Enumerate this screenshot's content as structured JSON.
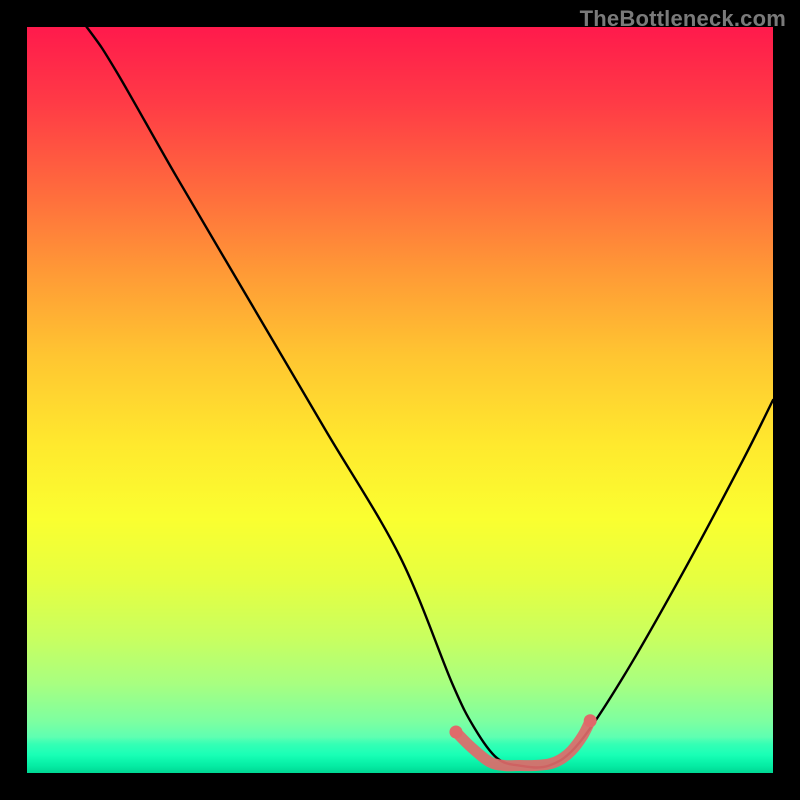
{
  "attribution": "TheBottleneck.com",
  "chart_data": {
    "type": "line",
    "title": "",
    "xlabel": "",
    "ylabel": "",
    "xlim": [
      0,
      100
    ],
    "ylim": [
      0,
      100
    ],
    "series": [
      {
        "name": "bottleneck-curve",
        "x": [
          0,
          8,
          12,
          20,
          30,
          40,
          50,
          57,
          60,
          63,
          66,
          70,
          74,
          80,
          88,
          96,
          100
        ],
        "y": [
          110,
          100,
          94,
          80,
          63,
          46,
          29,
          12,
          6,
          2,
          1,
          1,
          4,
          13,
          27,
          42,
          50
        ]
      }
    ],
    "flat_region": {
      "approx_center_x": 66,
      "approx_width": 16,
      "approx_y": 1
    },
    "flat_region_markers": [
      {
        "x": 57.5,
        "y": 5.5
      },
      {
        "x": 59.5,
        "y": 3.5
      },
      {
        "x": 62,
        "y": 1.5
      },
      {
        "x": 64,
        "y": 1
      },
      {
        "x": 66,
        "y": 1
      },
      {
        "x": 68,
        "y": 1
      },
      {
        "x": 70,
        "y": 1.2
      },
      {
        "x": 71.5,
        "y": 1.8
      },
      {
        "x": 73,
        "y": 3
      },
      {
        "x": 74.5,
        "y": 5
      },
      {
        "x": 75.5,
        "y": 7
      }
    ],
    "background_gradient": {
      "top": "#ff1a4c",
      "mid": "#ffe92e",
      "bottom": "#00ffd0"
    }
  }
}
